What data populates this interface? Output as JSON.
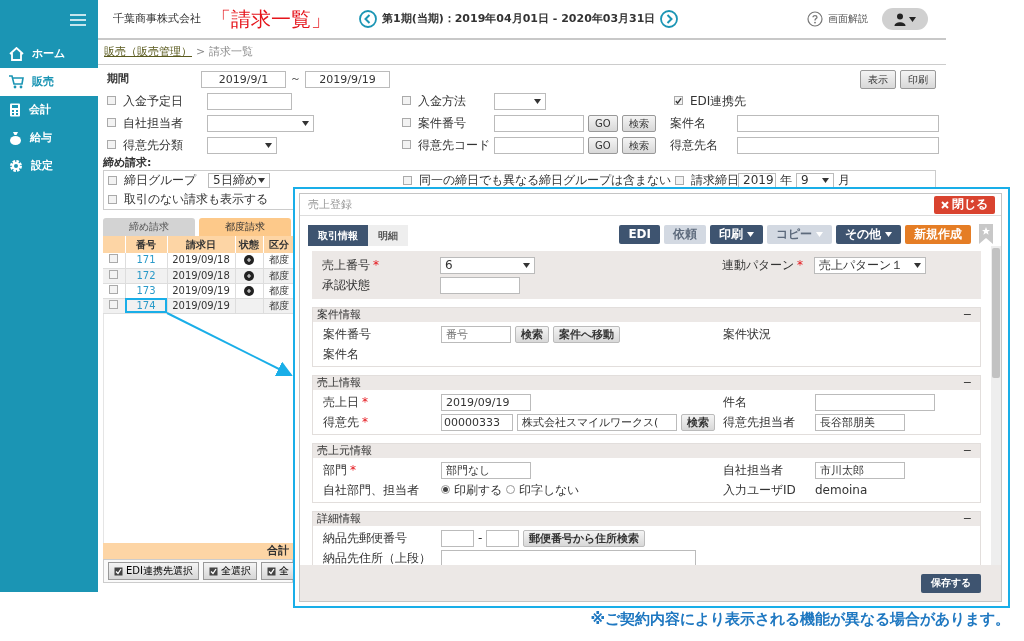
{
  "sidebar": {
    "items": [
      {
        "label": "ホーム",
        "selected": false
      },
      {
        "label": "販売",
        "selected": true
      },
      {
        "label": "会計",
        "selected": false
      },
      {
        "label": "給与",
        "selected": false
      },
      {
        "label": "設定",
        "selected": false
      }
    ]
  },
  "header": {
    "company": "千葉商事株式会社",
    "title": "「請求一覧」",
    "period": "第1期(当期)：2019年04月01日 - 2020年03月31日",
    "help": "画面解説"
  },
  "breadcrumb": {
    "link": "販売（販売管理）",
    "separator": ">",
    "current": "請求一覧"
  },
  "filters": {
    "period": {
      "label": "期間",
      "from": "2019/9/1",
      "tilde": "～",
      "to": "2019/9/19"
    },
    "buttons": [
      "表示",
      "印刷"
    ],
    "rows": [
      [
        {
          "label": "入金予定日",
          "checked": false,
          "controls": [
            {
              "kind": "input"
            }
          ]
        },
        {
          "label": "入金方法",
          "checked": false,
          "controls": [
            {
              "kind": "select"
            }
          ]
        },
        {
          "label": "EDI連携先",
          "checked": true
        }
      ],
      [
        {
          "label": "自社担当者",
          "checked": false,
          "controls": [
            {
              "kind": "select"
            }
          ]
        },
        {
          "label": "案件番号",
          "checked": false,
          "controls": [
            {
              "kind": "input"
            },
            {
              "kind": "button",
              "label": "GO"
            },
            {
              "kind": "button",
              "label": "検索"
            }
          ]
        },
        {
          "label": "案件名",
          "controls": [
            {
              "kind": "input"
            }
          ]
        }
      ],
      [
        {
          "label": "得意先分類",
          "checked": false,
          "controls": [
            {
              "kind": "select"
            }
          ]
        },
        {
          "label": "得意先コード",
          "checked": false,
          "controls": [
            {
              "kind": "input"
            },
            {
              "kind": "button",
              "label": "GO"
            },
            {
              "kind": "button",
              "label": "検索"
            }
          ]
        },
        {
          "label": "得意先名",
          "controls": [
            {
              "kind": "input"
            }
          ]
        }
      ]
    ],
    "closing": {
      "label": "締め請求:",
      "rows": [
        [
          {
            "label": "締日グループ",
            "checked": false,
            "controls": [
              {
                "kind": "select",
                "value": "5日締め"
              }
            ]
          },
          {
            "label": "同一の締日でも異なる締日グループは含まない",
            "checked": false
          },
          {
            "label": "請求締日",
            "checked": false,
            "controls": [
              {
                "kind": "select",
                "value": "2019"
              },
              {
                "kind": "text",
                "label": "年"
              },
              {
                "kind": "select",
                "value": "9"
              },
              {
                "kind": "text",
                "label": "月"
              }
            ]
          }
        ],
        [
          {
            "label": "取引のない請求も表示する",
            "checked": false
          }
        ]
      ]
    }
  },
  "list": {
    "tabs": [
      {
        "label": "締め請求",
        "selected": false
      },
      {
        "label": "都度請求",
        "selected": true
      }
    ],
    "columns": [
      "番号",
      "請求日",
      "状態",
      "区分"
    ],
    "rows": [
      {
        "checked": false,
        "number": "171",
        "date": "2019/09/18",
        "issued": true,
        "type": "都度",
        "highlighted": false
      },
      {
        "checked": false,
        "number": "172",
        "date": "2019/09/18",
        "issued": true,
        "type": "都度",
        "highlighted": false
      },
      {
        "checked": false,
        "number": "173",
        "date": "2019/09/19",
        "issued": true,
        "type": "都度",
        "highlighted": false
      },
      {
        "checked": false,
        "number": "174",
        "date": "2019/09/19",
        "issued": false,
        "type": "都度",
        "highlighted": true
      }
    ],
    "total_label": "合計",
    "buttons": [
      "EDI連携先選択",
      "全選択",
      "全"
    ]
  },
  "dialog": {
    "title": "売上登録",
    "close": "閉じる",
    "tabs": [
      {
        "label": "取引情報",
        "selected": true
      },
      {
        "label": "明細",
        "selected": false
      }
    ],
    "toolbar": [
      {
        "label": "EDI",
        "kind": "dark",
        "disabled": false,
        "dropdown": false
      },
      {
        "label": "依頼",
        "kind": "dark",
        "disabled": true,
        "dropdown": false
      },
      {
        "label": "印刷",
        "kind": "dark",
        "disabled": false,
        "dropdown": true
      },
      {
        "label": "コピー",
        "kind": "dark",
        "disabled": true,
        "dropdown": true
      },
      {
        "label": "その他",
        "kind": "dark",
        "disabled": false,
        "dropdown": true
      },
      {
        "label": "新規作成",
        "kind": "accent",
        "disabled": false,
        "dropdown": false
      }
    ],
    "top_fields": [
      [
        {
          "label": "売上番号",
          "required": "*",
          "controls": [
            {
              "kind": "select",
              "value": "6"
            }
          ]
        },
        {
          "label": "連動パターン",
          "required": "*",
          "controls": [
            {
              "kind": "select",
              "value": "売上パターン１"
            }
          ]
        }
      ],
      [
        {
          "label": "承認状態",
          "controls": [
            {
              "kind": "input"
            }
          ]
        }
      ]
    ],
    "sections": [
      {
        "title": "案件情報",
        "toggle": "−",
        "rows": [
          [
            {
              "label": "案件番号",
              "controls": [
                {
                  "kind": "input",
                  "placeholder": "番号"
                },
                {
                  "kind": "button",
                  "label": "検索"
                },
                {
                  "kind": "button",
                  "label": "案件へ移動"
                }
              ]
            },
            {
              "label": "案件状況"
            }
          ],
          [
            {
              "label": "案件名"
            }
          ]
        ]
      },
      {
        "title": "売上情報",
        "toggle": "−",
        "rows": [
          [
            {
              "label": "売上日",
              "required": "*",
              "controls": [
                {
                  "kind": "input",
                  "value": "2019/09/19"
                }
              ]
            },
            {
              "label": "件名",
              "controls": [
                {
                  "kind": "input"
                }
              ]
            }
          ],
          [
            {
              "label": "得意先",
              "required": "*",
              "controls": [
                {
                  "kind": "input",
                  "value": "00000333"
                },
                {
                  "kind": "input",
                  "value": "株式会社スマイルワークス("
                },
                {
                  "kind": "button",
                  "label": "検索"
                }
              ]
            },
            {
              "label": "得意先担当者",
              "controls": [
                {
                  "kind": "input",
                  "value": "長谷部朋美"
                }
              ]
            }
          ]
        ]
      },
      {
        "title": "売上元情報",
        "toggle": "−",
        "rows": [
          [
            {
              "label": "部門",
              "required": "*",
              "controls": [
                {
                  "kind": "input",
                  "value": "部門なし"
                }
              ]
            },
            {
              "label": "自社担当者",
              "controls": [
                {
                  "kind": "input",
                  "value": "市川太郎"
                }
              ]
            }
          ],
          [
            {
              "label": "自社部門、担当者",
              "controls": [
                {
                  "kind": "radio",
                  "label": "印刷する",
                  "selected": true
                },
                {
                  "kind": "radio",
                  "label": "印字しない",
                  "selected": false
                }
              ]
            },
            {
              "label": "入力ユーザID",
              "controls": [
                {
                  "kind": "text",
                  "label": "demoina"
                }
              ]
            }
          ]
        ]
      },
      {
        "title": "詳細情報",
        "toggle": "−",
        "rows": [
          [
            {
              "label": "納品先郵便番号",
              "controls": [
                {
                  "kind": "input"
                },
                {
                  "kind": "text",
                  "label": "-"
                },
                {
                  "kind": "input"
                },
                {
                  "kind": "button",
                  "label": "郵便番号から住所検索"
                }
              ]
            }
          ],
          [
            {
              "label": "納品先住所（上段）",
              "controls": [
                {
                  "kind": "input"
                }
              ]
            }
          ]
        ]
      }
    ],
    "save": "保存する"
  },
  "note": "※ご契約内容により表示される機能が異なる場合があります。"
}
